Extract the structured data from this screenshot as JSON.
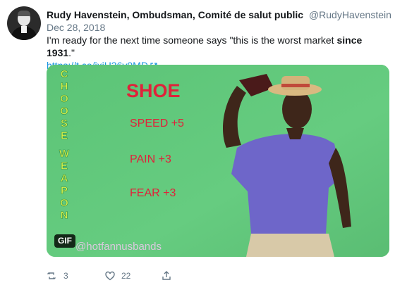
{
  "tweet": {
    "author_name": "Rudy Havenstein, Ombudsman, Comité de salut public",
    "author_handle": "@RudyHavenstein",
    "date": "Dec 28, 2018",
    "text_before": "I'm ready for the next time someone says \"this is the worst market ",
    "text_bold": "since 1931",
    "text_after": ".\"",
    "link": "https://t.co/jxiH36y9MD",
    "link_icon": "external-link-icon"
  },
  "media": {
    "badge": "GIF",
    "side_text": "CHOOSE WEAPON",
    "title": "SHOE",
    "stats": [
      "SPEED +5",
      "PAIN +3",
      "FEAR +3"
    ],
    "watermark": "@hotfannusbands",
    "background_color": "#62c77b",
    "title_color": "#e0223a",
    "side_text_color": "#d8f04a"
  },
  "actions": {
    "retweet_icon": "retweet-icon",
    "retweet_count": "3",
    "like_icon": "heart-icon",
    "like_count": "22",
    "share_icon": "share-icon"
  }
}
